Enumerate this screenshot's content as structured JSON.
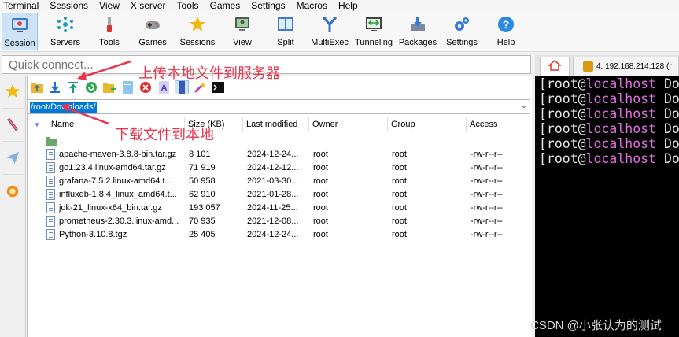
{
  "menubar": [
    "Terminal",
    "Sessions",
    "View",
    "X server",
    "Tools",
    "Games",
    "Settings",
    "Macros",
    "Help"
  ],
  "toolbar": {
    "session": "Session",
    "servers": "Servers",
    "tools": "Tools",
    "games": "Games",
    "sessions": "Sessions",
    "view": "View",
    "split": "Split",
    "multiexec": "MultiExec",
    "tunneling": "Tunneling",
    "packages": "Packages",
    "settings": "Settings",
    "help": "Help"
  },
  "quick_connect": {
    "placeholder": "Quick connect..."
  },
  "tab": {
    "label": "4. 192.168.214.128 (r"
  },
  "sftp": {
    "path": "/root/Downloads/",
    "columns": [
      "Name",
      "Size (KB)",
      "Last modified",
      "Owner",
      "Group",
      "Access"
    ],
    "parent": "..",
    "files": [
      {
        "name": "apache-maven-3.8.8-bin.tar.gz",
        "size": "8 101",
        "modified": "2024-12-24...",
        "owner": "root",
        "group": "root",
        "access": "-rw-r--r--"
      },
      {
        "name": "go1.23.4.linux-amd64.tar.gz",
        "size": "71 919",
        "modified": "2024-12-12...",
        "owner": "root",
        "group": "root",
        "access": "-rw-r--r--"
      },
      {
        "name": "grafana-7.5.2.linux-amd64.t...",
        "size": "50 958",
        "modified": "2021-03-30...",
        "owner": "root",
        "group": "root",
        "access": "-rw-r--r--"
      },
      {
        "name": "influxdb-1.8.4_linux_amd64.t...",
        "size": "62 910",
        "modified": "2021-01-28...",
        "owner": "root",
        "group": "root",
        "access": "-rw-r--r--"
      },
      {
        "name": "jdk-21_linux-x64_bin.tar.gz",
        "size": "193 057",
        "modified": "2024-11-25...",
        "owner": "root",
        "group": "root",
        "access": "-rw-r--r--"
      },
      {
        "name": "prometheus-2.30.3.linux-amd...",
        "size": "70 935",
        "modified": "2021-12-08...",
        "owner": "root",
        "group": "root",
        "access": "-rw-r--r--"
      },
      {
        "name": "Python-3.10.8.tgz",
        "size": "25 405",
        "modified": "2024-12-24...",
        "owner": "root",
        "group": "root",
        "access": "-rw-r--r--"
      }
    ]
  },
  "terminal": {
    "lines": [
      {
        "a": "[root@",
        "host": "localhost",
        "b": " Do"
      },
      {
        "a": "[root@",
        "host": "localhost",
        "b": " Do"
      },
      {
        "a": "[root@",
        "host": "localhost",
        "b": " Do"
      },
      {
        "a": "[root@",
        "host": "localhost",
        "b": " Do"
      },
      {
        "a": "[root@",
        "host": "localhost",
        "b": " Do"
      },
      {
        "a": "[root@",
        "host": "localhost",
        "b": " Do"
      }
    ]
  },
  "annotations": {
    "upload": "上传本地文件到服务器",
    "download": "下载文件到本地"
  },
  "watermark": "CSDN @小张认为的测试",
  "colors": {
    "annotation": "#e8354e",
    "selection": "#0078d7",
    "terminal_host": "#e070e0"
  }
}
